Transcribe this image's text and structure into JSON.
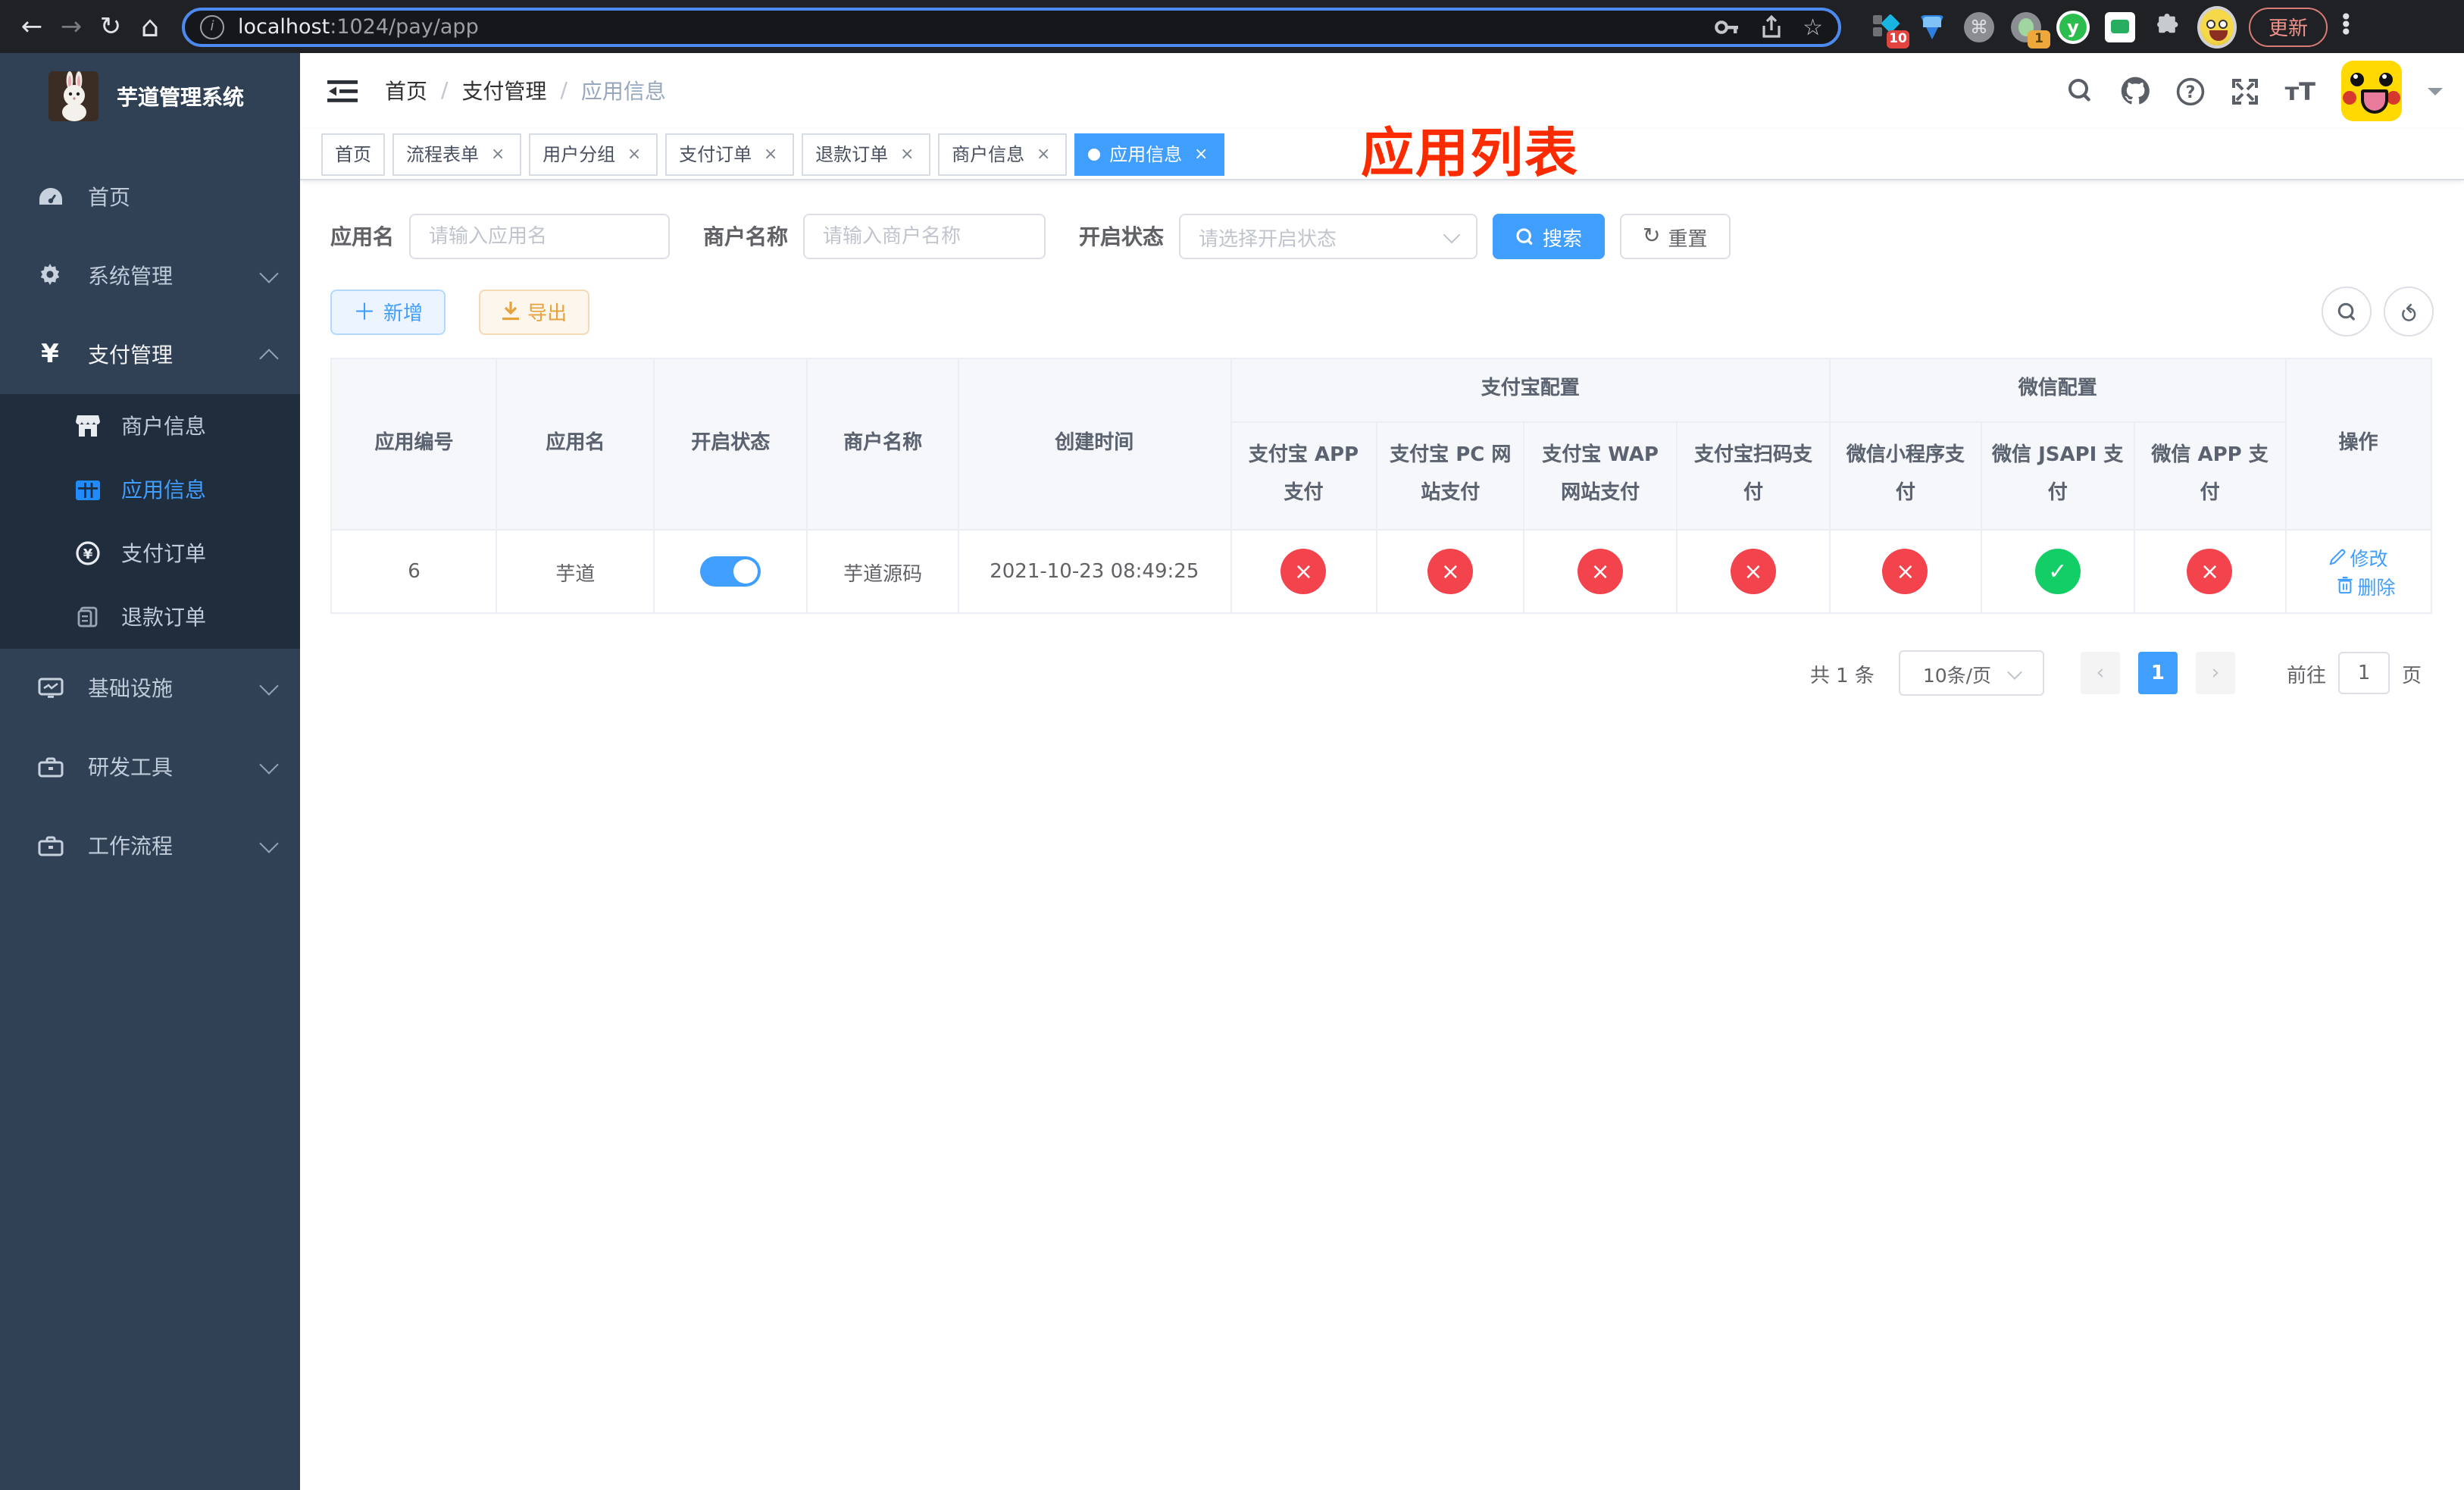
{
  "browser": {
    "url": {
      "host": "localhost",
      "path": ":1024/pay/app"
    },
    "update_label": "更新",
    "ext1_badge": "10",
    "ext2_badge": "1",
    "yuque_letter": "y"
  },
  "sidebar": {
    "title": "芋道管理系统",
    "items": [
      {
        "label": "首页"
      },
      {
        "label": "系统管理"
      },
      {
        "label": "支付管理"
      },
      {
        "label": "基础设施"
      },
      {
        "label": "研发工具"
      },
      {
        "label": "工作流程"
      }
    ],
    "subitems": [
      {
        "label": "商户信息"
      },
      {
        "label": "应用信息"
      },
      {
        "label": "支付订单"
      },
      {
        "label": "退款订单"
      }
    ]
  },
  "header": {
    "breadcrumb": [
      "首页",
      "支付管理",
      "应用信息"
    ],
    "overlay_title": "应用列表"
  },
  "tabs": [
    {
      "label": "首页"
    },
    {
      "label": "流程表单"
    },
    {
      "label": "用户分组"
    },
    {
      "label": "支付订单"
    },
    {
      "label": "退款订单"
    },
    {
      "label": "商户信息"
    },
    {
      "label": "应用信息"
    }
  ],
  "filters": {
    "app_name_label": "应用名",
    "app_name_placeholder": "请输入应用名",
    "merchant_label": "商户名称",
    "merchant_placeholder": "请输入商户名称",
    "status_label": "开启状态",
    "status_placeholder": "请选择开启状态",
    "search_label": "搜索",
    "reset_label": "重置"
  },
  "toolbar": {
    "add_label": "新增",
    "export_label": "导出"
  },
  "table": {
    "cols": [
      "应用编号",
      "应用名",
      "开启状态",
      "商户名称",
      "创建时间"
    ],
    "groups": [
      {
        "label": "支付宝配置",
        "children": [
          "支付宝 APP 支付",
          "支付宝 PC 网站支付",
          "支付宝 WAP 网站支付",
          "支付宝扫码支付"
        ]
      },
      {
        "label": "微信配置",
        "children": [
          "微信小程序支付",
          "微信 JSAPI 支付",
          "微信 APP 支付"
        ]
      }
    ],
    "ops_label": "操作",
    "row": {
      "id": "6",
      "name": "芋道",
      "enabled": true,
      "merchant": "芋道源码",
      "created_at": "2021-10-23 08:49:25",
      "channels": [
        false,
        false,
        false,
        false,
        false,
        true,
        false
      ],
      "edit_label": "修改",
      "delete_label": "删除"
    }
  },
  "pagination": {
    "total": "共 1 条",
    "page_size": "10条/页",
    "page": "1",
    "goto_label": "前往",
    "goto_value": "1",
    "unit_label": "页"
  },
  "colors": {
    "primary": "#409eff",
    "success": "#13ce66",
    "danger": "#f3434c",
    "warning": "#e6a23c",
    "sidebar_bg": "#304156",
    "submenu_bg": "#1f2d3d",
    "annotation_red": "#fb2b00"
  }
}
